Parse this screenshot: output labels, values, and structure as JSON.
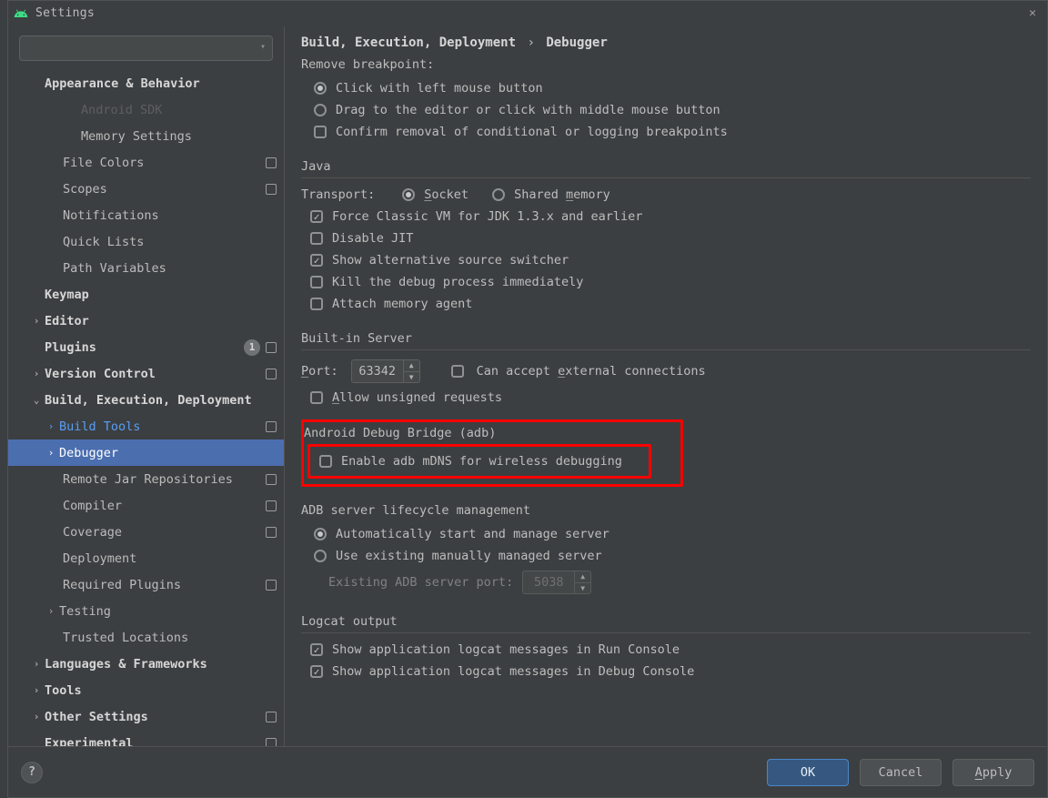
{
  "titlebar": {
    "title": "Settings"
  },
  "search": {
    "placeholder": ""
  },
  "crumbs": {
    "root": "Build, Execution, Deployment",
    "sep": "›",
    "leaf": "Debugger"
  },
  "sidebar": {
    "appearance": "Appearance & Behavior",
    "android_sdk": "Android SDK",
    "memory": "Memory Settings",
    "file_colors": "File Colors",
    "scopes": "Scopes",
    "notifications": "Notifications",
    "quick_lists": "Quick Lists",
    "path_vars": "Path Variables",
    "keymap": "Keymap",
    "editor": "Editor",
    "plugins": "Plugins",
    "plugins_badge": "1",
    "vcs": "Version Control",
    "bed": "Build, Execution, Deployment",
    "build_tools": "Build Tools",
    "debugger": "Debugger",
    "remote_jar": "Remote Jar Repositories",
    "compiler": "Compiler",
    "coverage": "Coverage",
    "deployment": "Deployment",
    "required_plugins": "Required Plugins",
    "testing": "Testing",
    "trusted": "Trusted Locations",
    "lang": "Languages & Frameworks",
    "tools": "Tools",
    "other": "Other Settings",
    "experimental": "Experimental"
  },
  "remove_bp": {
    "heading": "Remove breakpoint:",
    "left_click": "Click with left mouse button",
    "drag_middle": "Drag to the editor or click with middle mouse button",
    "confirm": "Confirm removal of conditional or logging breakpoints"
  },
  "java": {
    "heading": "Java",
    "transport": "Transport:",
    "socket_pre": "S",
    "socket_rest": "ocket",
    "shared_pre": "Shared ",
    "shared_u": "m",
    "shared_post": "emory",
    "force_classic": "Force Classic VM for JDK 1.3.x and earlier",
    "disable_jit": "Disable JIT",
    "alt_src": "Show alternative source switcher",
    "kill_dbg": "Kill the debug process immediately",
    "attach_mem": "Attach memory agent"
  },
  "server": {
    "heading": "Built-in Server",
    "port_pre": "P",
    "port_rest": "ort:",
    "port_val": "63342",
    "ext_pre": "Can accept ",
    "ext_u": "e",
    "ext_post": "xternal connections",
    "allow_pre": "A",
    "allow_rest": "llow unsigned requests"
  },
  "adb": {
    "heading": "Android Debug Bridge (adb)",
    "enable_mdns": "Enable adb mDNS for wireless debugging",
    "lifecycle": "ADB server lifecycle management",
    "auto": "Automatically start and manage server",
    "existing": "Use existing manually managed server",
    "existing_port_lbl": "Existing ADB server port:",
    "existing_port_val": "5038"
  },
  "logcat": {
    "heading": "Logcat output",
    "run": "Show application logcat messages in Run Console",
    "debug": "Show application logcat messages in Debug Console"
  },
  "footer": {
    "ok": "OK",
    "cancel": "Cancel",
    "apply_u": "A",
    "apply_rest": "pply"
  }
}
